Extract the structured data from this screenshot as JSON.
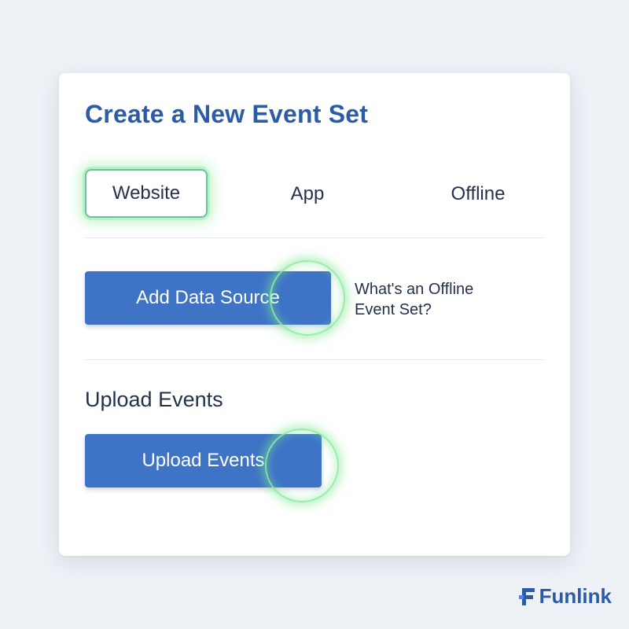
{
  "dialog": {
    "title": "Create a New Event Set"
  },
  "tabs": [
    {
      "label": "Website",
      "selected": true
    },
    {
      "label": "App",
      "selected": false
    },
    {
      "label": "Offline",
      "selected": false
    }
  ],
  "data_source": {
    "button_label": "Add Data Source",
    "help_link": "What's an Offline Event Set?"
  },
  "upload": {
    "heading": "Upload Events",
    "button_label": "Upload Events"
  },
  "brand": {
    "name": "Funlink",
    "icon": "funlink-logo-icon"
  },
  "colors": {
    "accent": "#2a5ca8",
    "button": "#3e73c6",
    "highlight_glow": "#7be68a",
    "background": "#eef1f6"
  }
}
